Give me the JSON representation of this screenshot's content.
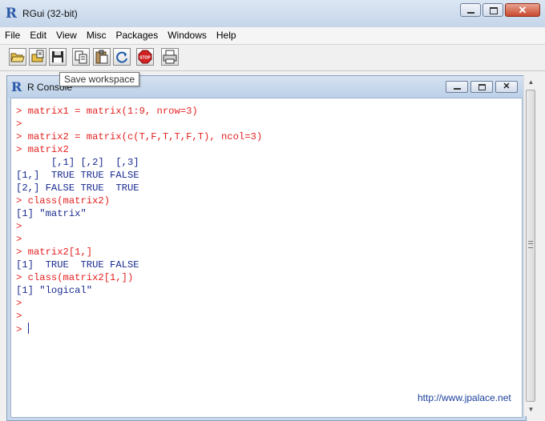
{
  "app": {
    "title": "RGui (32-bit)",
    "icon": "r-logo-icon"
  },
  "menu": [
    "File",
    "Edit",
    "View",
    "Misc",
    "Packages",
    "Windows",
    "Help"
  ],
  "toolbar": {
    "buttons": [
      "open-script",
      "load-workspace",
      "save-workspace",
      "copy",
      "paste",
      "copy-paste",
      "stop",
      "print"
    ],
    "tooltip": "Save workspace",
    "stop_label": "STOP"
  },
  "console": {
    "title": "R Console",
    "lines": [
      {
        "kind": "input",
        "text": "> matrix1 = matrix(1:9, nrow=3)"
      },
      {
        "kind": "input",
        "text": ">"
      },
      {
        "kind": "input",
        "text": "> matrix2 = matrix(c(T,F,T,T,F,T), ncol=3)"
      },
      {
        "kind": "input",
        "text": "> matrix2"
      },
      {
        "kind": "output",
        "text": "      [,1] [,2]  [,3]"
      },
      {
        "kind": "output",
        "text": "[1,]  TRUE TRUE FALSE"
      },
      {
        "kind": "output",
        "text": "[2,] FALSE TRUE  TRUE"
      },
      {
        "kind": "input",
        "text": "> class(matrix2)"
      },
      {
        "kind": "output",
        "text": "[1] \"matrix\""
      },
      {
        "kind": "input",
        "text": ">"
      },
      {
        "kind": "input",
        "text": ">"
      },
      {
        "kind": "input",
        "text": "> matrix2[1,]"
      },
      {
        "kind": "output",
        "text": "[1]  TRUE  TRUE FALSE"
      },
      {
        "kind": "input",
        "text": "> class(matrix2[1,])"
      },
      {
        "kind": "output",
        "text": "[1] \"logical\""
      },
      {
        "kind": "input",
        "text": ">"
      },
      {
        "kind": "input",
        "text": ">"
      },
      {
        "kind": "input",
        "text": "> "
      }
    ],
    "prompt_color": "#e41f1f",
    "output_color": "#1b2c8f"
  },
  "watermark": "http://www.jpalace.net"
}
